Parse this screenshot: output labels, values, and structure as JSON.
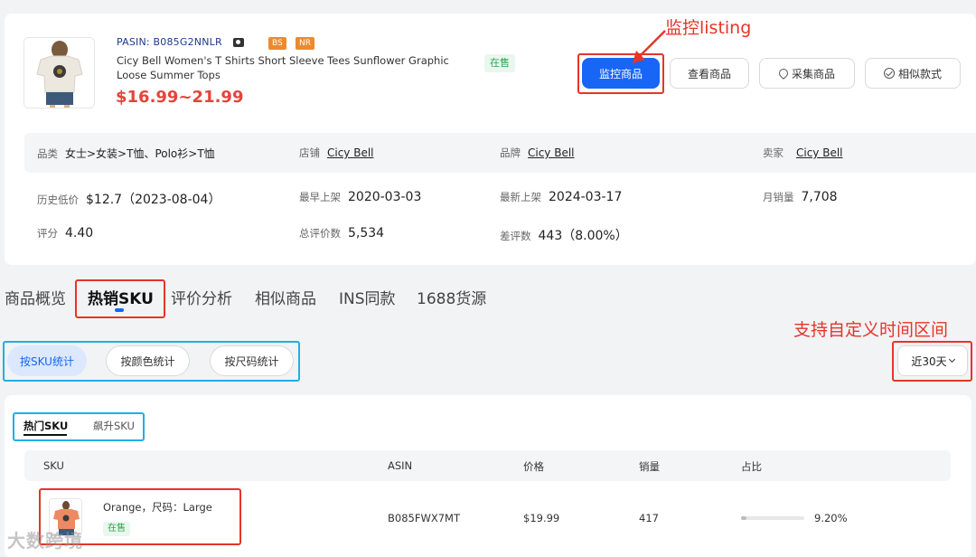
{
  "product": {
    "pasin": "PASIN: B085G2NNLR",
    "tags": [
      "BS",
      "NR"
    ],
    "title": "Cicy Bell Women's T Shirts Short Sleeve Tees Sunflower Graphic Loose Summer Tops",
    "price": "$16.99~21.99",
    "status": "在售"
  },
  "actions": {
    "monitor": "监控商品",
    "view": "查看商品",
    "collect": "采集商品",
    "similar": "相似款式"
  },
  "annotations": {
    "monitor_listing": "监控listing",
    "custom_range": "支持自定义时间区间"
  },
  "info": {
    "category_label": "品类",
    "category_value": "女士>女装>T恤、Polo衫>T恤",
    "store_label": "店铺",
    "store_value": "Cicy Bell",
    "brand_label": "品牌",
    "brand_value": "Cicy Bell",
    "seller_label": "卖家",
    "seller_value": "Cicy Bell",
    "lowest_label": "历史低价",
    "lowest_value": "$12.7（2023-08-04）",
    "earliest_label": "最早上架",
    "earliest_value": "2020-03-03",
    "latest_label": "最新上架",
    "latest_value": "2024-03-17",
    "monthly_label": "月销量",
    "monthly_value": "7,708",
    "rating_label": "评分",
    "rating_value": "4.40",
    "reviews_label": "总评价数",
    "reviews_value": "5,534",
    "bad_label": "差评数",
    "bad_value": "443（8.00%）"
  },
  "tabs": [
    "商品概览",
    "热销SKU",
    "评价分析",
    "相似商品",
    "INS同款",
    "1688货源"
  ],
  "stat_modes": [
    "按SKU统计",
    "按颜色统计",
    "按尺码统计"
  ],
  "range": "近30天",
  "subtabs": [
    "热门SKU",
    "飙升SKU"
  ],
  "table": {
    "headers": [
      "SKU",
      "ASIN",
      "价格",
      "销量",
      "占比"
    ],
    "rows": [
      {
        "sku": "Orange，尺码：Large",
        "status": "在售",
        "asin": "B085FWX7MT",
        "price": "$19.99",
        "sales": "417",
        "share": "9.20%",
        "share_value": 0.092
      }
    ]
  },
  "watermark": "大数跨境"
}
